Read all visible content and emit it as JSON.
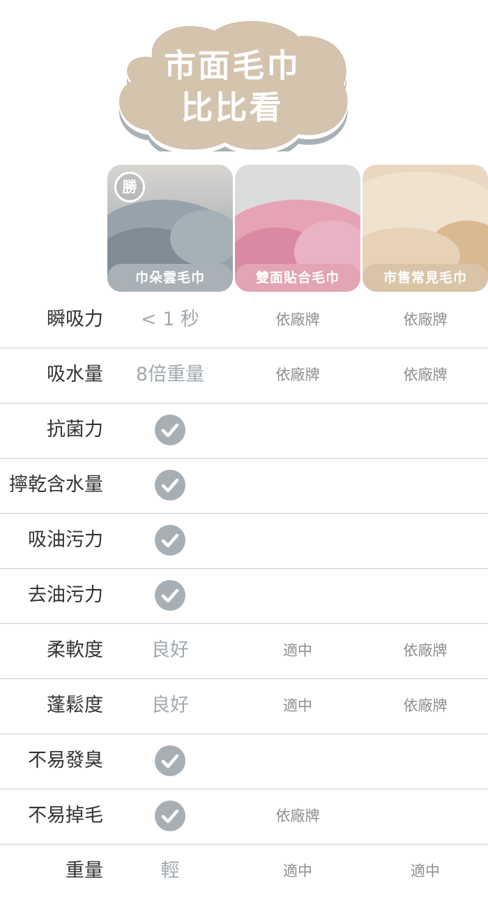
{
  "title": {
    "line1": "市面毛巾",
    "line2": "比比看"
  },
  "colors": {
    "cloud": "#d4c3ad",
    "cloud_shadow": "#a9b1b6",
    "gray": "#a9b1b6",
    "pink": "#e3a4b4",
    "beige": "#d9c4a8"
  },
  "products": [
    {
      "label": "巾朵雲毛巾",
      "badge": "勝",
      "icon": "winner-badge-icon"
    },
    {
      "label": "雙面貼合毛巾"
    },
    {
      "label": "市售常見毛巾"
    }
  ],
  "rows": [
    {
      "feature": "瞬吸力",
      "c1": "< 1 秒",
      "c2": "依廠牌",
      "c3": "依廠牌"
    },
    {
      "feature": "吸水量",
      "c1": "8倍重量",
      "c2": "依廠牌",
      "c3": "依廠牌"
    },
    {
      "feature": "抗菌力",
      "c1_check": true,
      "c2": "",
      "c3": ""
    },
    {
      "feature": "擰乾含水量",
      "c1_check": true,
      "c2": "",
      "c3": ""
    },
    {
      "feature": "吸油污力",
      "c1_check": true,
      "c2": "",
      "c3": ""
    },
    {
      "feature": "去油污力",
      "c1_check": true,
      "c2": "",
      "c3": ""
    },
    {
      "feature": "柔軟度",
      "c1": "良好",
      "c2": "適中",
      "c3": "依廠牌"
    },
    {
      "feature": "蓬鬆度",
      "c1": "良好",
      "c2": "適中",
      "c3": "依廠牌"
    },
    {
      "feature": "不易發臭",
      "c1_check": true,
      "c2": "",
      "c3": ""
    },
    {
      "feature": "不易掉毛",
      "c1_check": true,
      "c2": "依廠牌",
      "c3": ""
    },
    {
      "feature": "重量",
      "c1": "輕",
      "c2": "適中",
      "c3": "適中"
    }
  ]
}
